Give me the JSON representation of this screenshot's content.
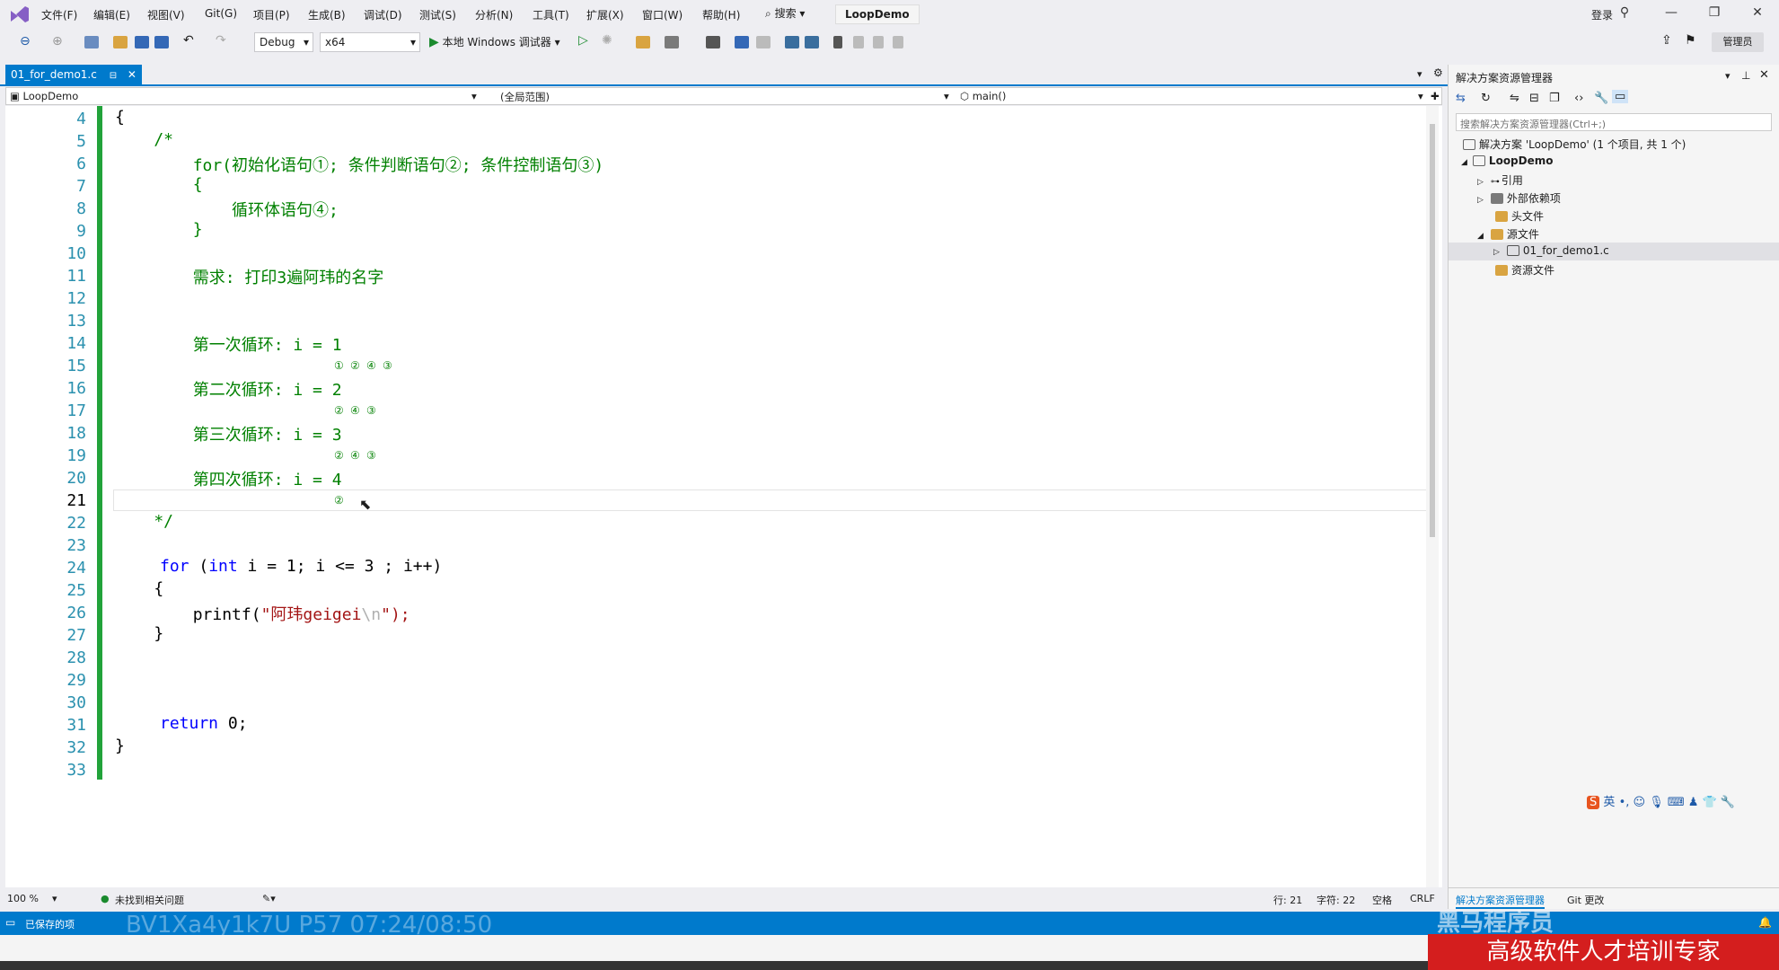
{
  "menu": {
    "items": [
      "文件(F)",
      "编辑(E)",
      "视图(V)",
      "Git(G)",
      "项目(P)",
      "生成(B)",
      "调试(D)",
      "测试(S)",
      "分析(N)",
      "工具(T)",
      "扩展(X)",
      "窗口(W)",
      "帮助(H)"
    ],
    "search_label": "搜索",
    "solution_name": "LoopDemo",
    "login": "登录"
  },
  "toolbar": {
    "config": "Debug",
    "platform": "x64",
    "run_label": "本地 Windows 调试器",
    "admin_label": "管理员"
  },
  "tab": {
    "file": "01_for_demo1.c"
  },
  "navbar": {
    "project": "LoopDemo",
    "scope": "(全局范围)",
    "member": "main()"
  },
  "editor": {
    "line_numbers": [
      "4",
      "5",
      "6",
      "7",
      "8",
      "9",
      "10",
      "11",
      "12",
      "13",
      "14",
      "15",
      "16",
      "17",
      "18",
      "19",
      "20",
      "21",
      "22",
      "23",
      "24",
      "25",
      "26",
      "27",
      "28",
      "29",
      "30",
      "31",
      "32",
      "33"
    ],
    "current_line": "21",
    "lines": {
      "l4": "{",
      "l5": "    /*",
      "l6": "        for(初始化语句①; 条件判断语句②; 条件控制语句③)",
      "l7": "        {",
      "l8": "            循环体语句④;",
      "l9": "        }",
      "l11": "        需求: 打印3遍阿玮的名字",
      "l14": "        第一次循环: i = 1",
      "l15": "① ② ④ ③",
      "l16": "        第二次循环: i = 2",
      "l17": "② ④ ③",
      "l18": "        第三次循环: i = 3",
      "l19": "② ④ ③",
      "l20": "        第四次循环: i = 4",
      "l21": "②",
      "l22": "    */",
      "l24_kw": "for",
      "l24_p1": " (",
      "l24_int": "int",
      "l24_rest": " i = 1; i <= 3 ; i++)",
      "l25": "    {",
      "l26_fn": "        printf(",
      "l26_str": "\"阿玮geigei",
      "l26_esc": "\\n",
      "l26_end": "\");",
      "l27": "    }",
      "l32_kw": "return",
      "l32_rest": " 0;",
      "l33": "}"
    }
  },
  "footer": {
    "zoom": "100 %",
    "issues": "未找到相关问题",
    "row": "行: 21",
    "col": "字符: 22",
    "spaces": "空格",
    "eol": "CRLF"
  },
  "solution_explorer": {
    "title": "解决方案资源管理器",
    "search_placeholder": "搜索解决方案资源管理器(Ctrl+;)",
    "tree": [
      "解决方案 'LoopDemo' (1 个项目, 共 1 个)",
      "LoopDemo",
      "引用",
      "外部依赖项",
      "头文件",
      "源文件",
      "01_for_demo1.c",
      "资源文件"
    ],
    "tab1": "解决方案资源管理器",
    "tab2": "Git 更改"
  },
  "statusbar": {
    "left": "已保存的项"
  },
  "overlay": {
    "video_id": "BV1Xa4y1k7U P57 07:24/08:50",
    "brand_top": "黑马程序员",
    "brand": "高级软件人才培训专家"
  },
  "colors": {
    "accent": "#007acc",
    "change_bar": "#22a33a",
    "comment": "#008000",
    "keyword": "#0000ff",
    "string": "#a31515",
    "brand_red": "#d41e1e"
  }
}
